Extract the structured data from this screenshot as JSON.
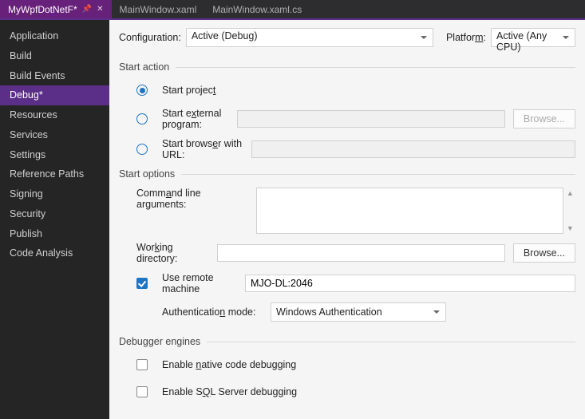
{
  "tabs": [
    {
      "label": "MyWpfDotNetF*",
      "active": true,
      "pinned": true,
      "closable": true
    },
    {
      "label": "MainWindow.xaml",
      "active": false
    },
    {
      "label": "MainWindow.xaml.cs",
      "active": false
    }
  ],
  "sidebar": {
    "items": [
      "Application",
      "Build",
      "Build Events",
      "Debug*",
      "Resources",
      "Services",
      "Settings",
      "Reference Paths",
      "Signing",
      "Security",
      "Publish",
      "Code Analysis"
    ],
    "selected": "Debug*"
  },
  "config": {
    "configuration_label": "Configuration:",
    "configuration_value": "Active (Debug)",
    "platform_label": "Platform:",
    "platform_value": "Active (Any CPU)"
  },
  "sections": {
    "start_action": {
      "title": "Start action",
      "start_project": "Start project",
      "start_external": "Start external program:",
      "start_browser": "Start browser with URL:",
      "browse": "Browse...",
      "selected": "project",
      "external_value": "",
      "url_value": ""
    },
    "start_options": {
      "title": "Start options",
      "cmdline_label": "Command line arguments:",
      "cmdline_value": "",
      "workdir_label": "Working directory:",
      "workdir_value": "",
      "workdir_browse": "Browse...",
      "remote_label": "Use remote machine",
      "remote_checked": true,
      "remote_value": "MJO-DL:2046",
      "auth_label": "Authentication mode:",
      "auth_value": "Windows Authentication"
    },
    "debugger": {
      "title": "Debugger engines",
      "native": "Enable native code debugging",
      "native_checked": false,
      "sql": "Enable SQL Server debugging",
      "sql_checked": false
    }
  }
}
